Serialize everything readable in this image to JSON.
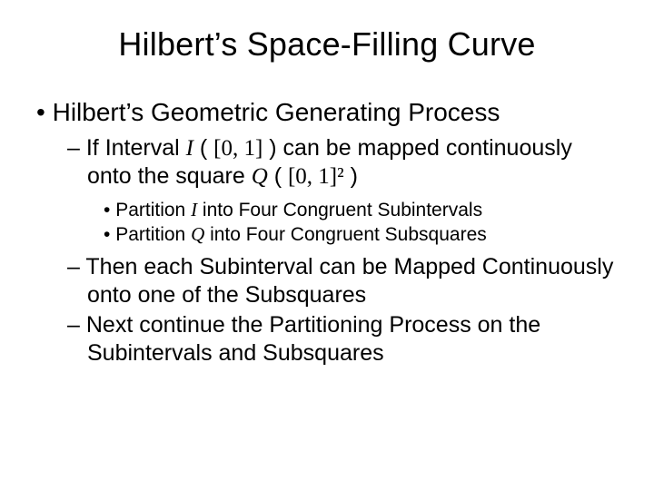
{
  "title": "Hilbert’s Space-Filling Curve",
  "l1": "Hilbert’s Geometric Generating Process",
  "l2a_pre": "If Interval ",
  "I": "I",
  "l2a_mid1": " ( ",
  "closed01": "[0, 1]",
  "l2a_mid2": " ) can be mapped continuously onto the square ",
  "Q": "Q",
  "l2a_mid3": " ( ",
  "closed01sq": "[0, 1]²",
  "l2a_end": " )",
  "l3a_pre": "Partition ",
  "l3a_post": " into Four Congruent Subintervals",
  "l3b_pre": "Partition ",
  "l3b_post": " into Four Congruent Subsquares",
  "l2b": "Then each Subinterval can be Mapped Continuously onto one of the Subsquares",
  "l2c": "Next continue the Partitioning Process on the Subintervals and Subsquares"
}
